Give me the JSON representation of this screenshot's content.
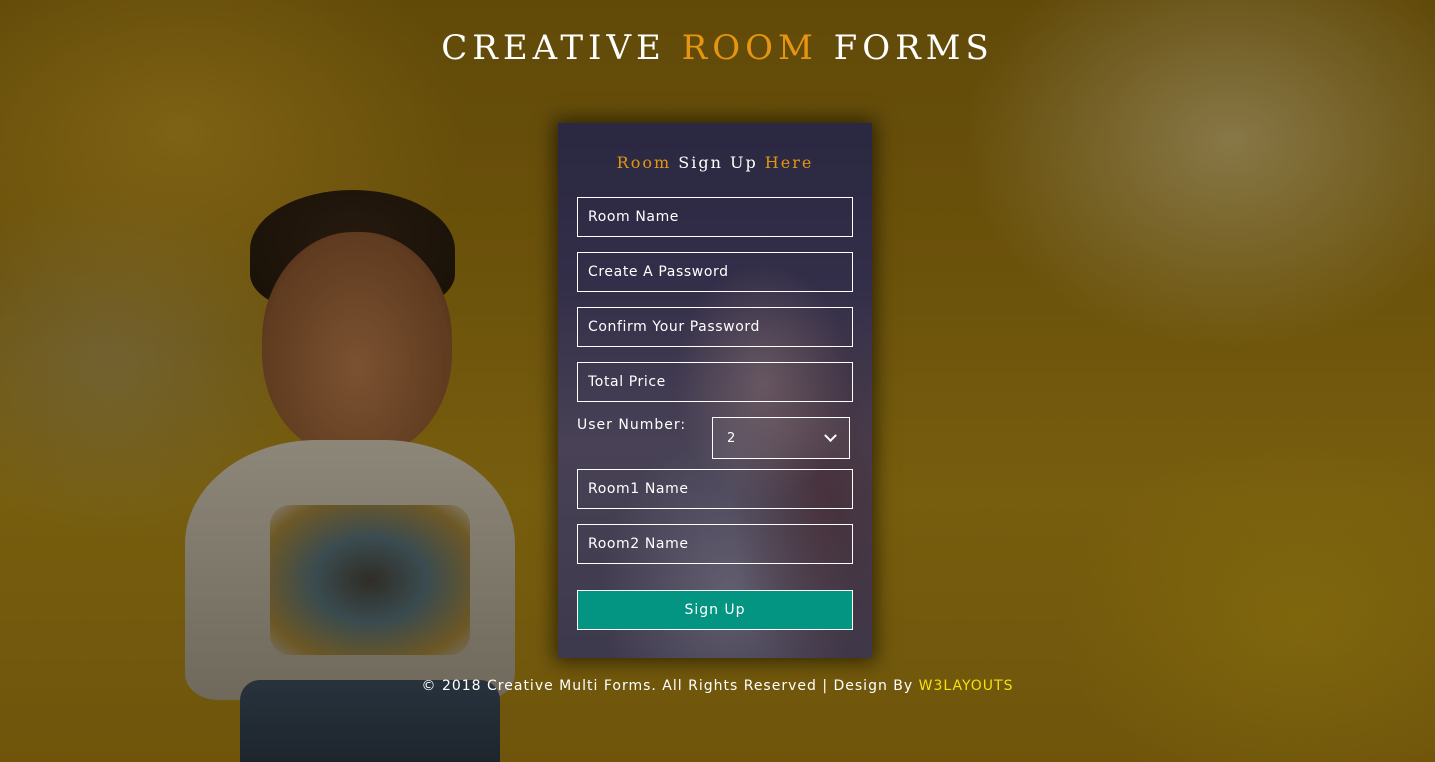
{
  "header": {
    "title_part1": "CREATIVE",
    "title_accent": "ROOM",
    "title_part2": "FORMS"
  },
  "form": {
    "title_accent1": "Room",
    "title_main": "Sign Up",
    "title_accent2": "Here",
    "room_name_placeholder": "Room Name",
    "password_placeholder": "Create A Password",
    "confirm_password_placeholder": "Confirm Your Password",
    "total_price_placeholder": "Total Price",
    "user_number_label": "User Number:",
    "user_number_value": "2",
    "room1_placeholder": "Room1 Name",
    "room2_placeholder": "Room2 Name",
    "submit_label": "Sign Up"
  },
  "footer": {
    "text": "© 2018 Creative Multi Forms. All Rights Reserved | Design By ",
    "brand": "W3LAYOUTS"
  },
  "colors": {
    "accent": "#e59512",
    "button": "#039482",
    "brand_link": "#f5e20a"
  }
}
